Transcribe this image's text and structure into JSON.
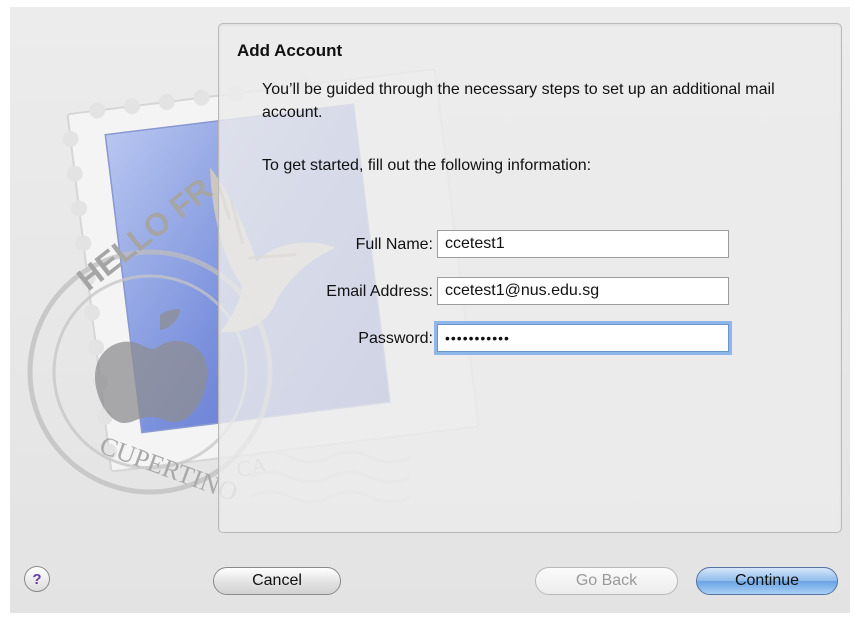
{
  "panel": {
    "title": "Add Account",
    "intro": "You’ll be guided through the necessary steps to set up an additional mail account.",
    "instruction": "To get started, fill out the following information:"
  },
  "form": {
    "full_name": {
      "label": "Full Name:",
      "value": "ccetest1"
    },
    "email": {
      "label": "Email Address:",
      "value": "ccetest1@nus.edu.sg"
    },
    "password": {
      "label": "Password:",
      "value": "•••••••••••"
    }
  },
  "stamp": {
    "top_text": "HELLO FR",
    "bottom_text": "CUPERTINO",
    "state_text": "CA"
  },
  "buttons": {
    "help": "?",
    "cancel": "Cancel",
    "go_back": "Go Back",
    "continue": "Continue"
  },
  "colors": {
    "accent": "#6aa3e3",
    "help_glyph": "#6a3aa6",
    "stamp_blue": "#6f86d6"
  },
  "icons": {
    "stamp": "mail-stamp-icon",
    "help": "help-icon"
  }
}
